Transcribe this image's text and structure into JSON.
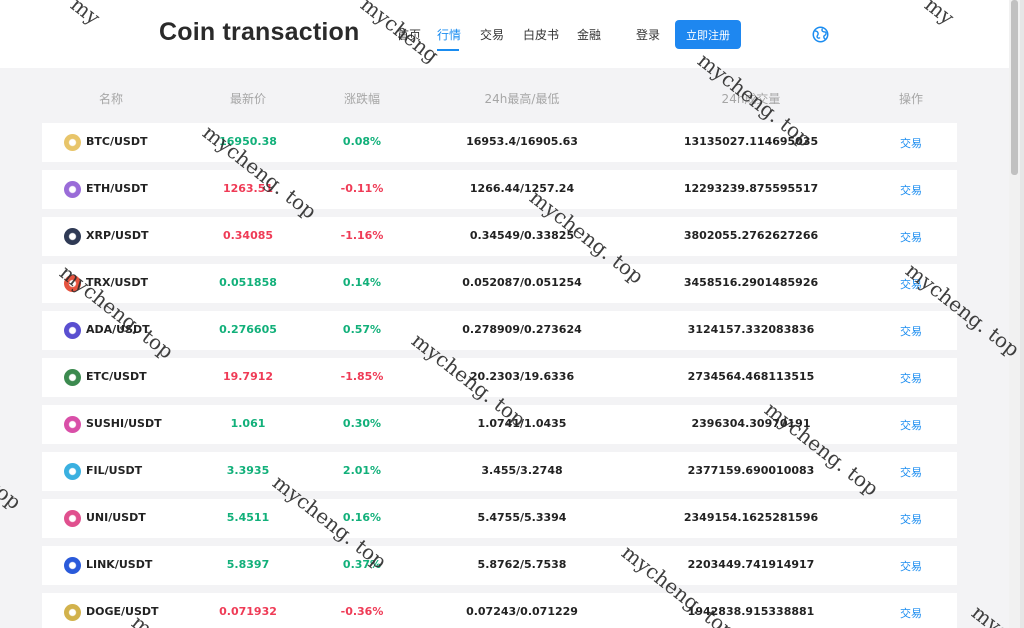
{
  "header": {
    "logo": "Coin transaction",
    "nav": [
      "首页",
      "行情",
      "交易",
      "白皮书",
      "金融"
    ],
    "active_nav": "行情",
    "login": "登录",
    "register": "立即注册"
  },
  "table": {
    "columns": [
      "名称",
      "最新价",
      "涨跌幅",
      "24h最高/最低",
      "24h成交量",
      "操作"
    ],
    "rows": [
      {
        "pair": "BTC/USDT",
        "price": "16950.38",
        "change": "0.08%",
        "direction": "up",
        "high_low": "16953.4/16905.63",
        "volume": "13135027.114695035",
        "action": "交易",
        "icon_color": "#e8c56a"
      },
      {
        "pair": "ETH/USDT",
        "price": "1263.51",
        "change": "-0.11%",
        "direction": "down",
        "high_low": "1266.44/1257.24",
        "volume": "12293239.875595517",
        "action": "交易",
        "icon_color": "#9a6cd8"
      },
      {
        "pair": "XRP/USDT",
        "price": "0.34085",
        "change": "-1.16%",
        "direction": "down",
        "high_low": "0.34549/0.33825",
        "volume": "3802055.2762627266",
        "action": "交易",
        "icon_color": "#2f3a55"
      },
      {
        "pair": "TRX/USDT",
        "price": "0.051858",
        "change": "0.14%",
        "direction": "up",
        "high_low": "0.052087/0.051254",
        "volume": "3458516.2901485926",
        "action": "交易",
        "icon_color": "#e5533f"
      },
      {
        "pair": "ADA/USDT",
        "price": "0.276605",
        "change": "0.57%",
        "direction": "up",
        "high_low": "0.278909/0.273624",
        "volume": "3124157.332083836",
        "action": "交易",
        "icon_color": "#5a4fd0"
      },
      {
        "pair": "ETC/USDT",
        "price": "19.7912",
        "change": "-1.85%",
        "direction": "down",
        "high_low": "20.2303/19.6336",
        "volume": "2734564.468113515",
        "action": "交易",
        "icon_color": "#3c8a4f"
      },
      {
        "pair": "SUSHI/USDT",
        "price": "1.061",
        "change": "0.30%",
        "direction": "up",
        "high_low": "1.0741/1.0435",
        "volume": "2396304.30970191",
        "action": "交易",
        "icon_color": "#d94fa8"
      },
      {
        "pair": "FIL/USDT",
        "price": "3.3935",
        "change": "2.01%",
        "direction": "up",
        "high_low": "3.455/3.2748",
        "volume": "2377159.690010083",
        "action": "交易",
        "icon_color": "#3ab0e0"
      },
      {
        "pair": "UNI/USDT",
        "price": "5.4511",
        "change": "0.16%",
        "direction": "up",
        "high_low": "5.4755/5.3394",
        "volume": "2349154.1625281596",
        "action": "交易",
        "icon_color": "#e0508e"
      },
      {
        "pair": "LINK/USDT",
        "price": "5.8397",
        "change": "0.37%",
        "direction": "up",
        "high_low": "5.8762/5.7538",
        "volume": "2203449.741914917",
        "action": "交易",
        "icon_color": "#2a5ada"
      },
      {
        "pair": "DOGE/USDT",
        "price": "0.071932",
        "change": "-0.36%",
        "direction": "down",
        "high_low": "0.07243/0.071229",
        "volume": "1942838.915338881",
        "action": "交易",
        "icon_color": "#d2b24c"
      }
    ]
  },
  "watermark": {
    "text": "mycheng. top",
    "fragments": [
      "top",
      "mycheng",
      "my",
      "myc"
    ]
  },
  "colors": {
    "accent": "#1a8cf0",
    "up": "#12b07a",
    "down": "#ef3b56"
  }
}
